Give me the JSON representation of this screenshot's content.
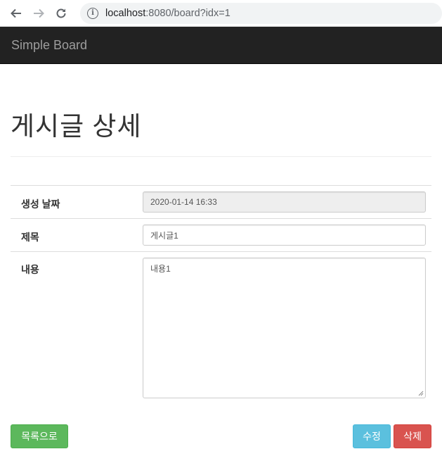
{
  "browser": {
    "url_host": "localhost",
    "url_rest": ":8080/board?idx=1"
  },
  "navbar": {
    "brand": "Simple Board"
  },
  "page": {
    "title": "게시글 상세"
  },
  "form": {
    "created_label": "생성 날짜",
    "created_value": "2020-01-14 16:33",
    "title_label": "제목",
    "title_value": "게시글1",
    "content_label": "내용",
    "content_value": "내용1"
  },
  "actions": {
    "list_label": "목록으로",
    "edit_label": "수정",
    "delete_label": "삭제"
  },
  "colors": {
    "list_button": "#5cb85c",
    "edit_button": "#5bc0de",
    "delete_button": "#d9534f",
    "navbar": "#222222"
  }
}
